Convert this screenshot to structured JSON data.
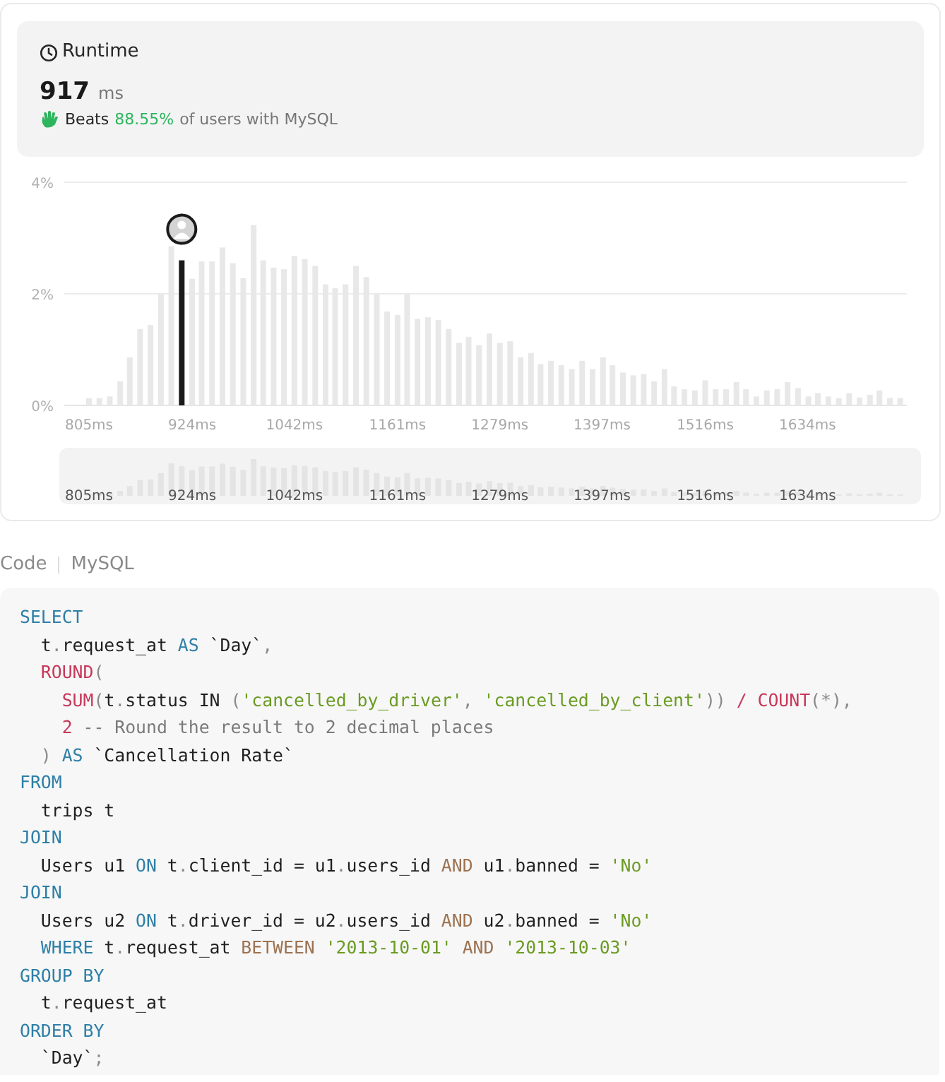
{
  "runtime": {
    "title": "Runtime",
    "value": "917",
    "unit": "ms",
    "beats_label": "Beats",
    "beats_percent": "88.55%",
    "beats_suffix": "of users with MySQL"
  },
  "chart": {
    "chart_data": {
      "type": "bar",
      "stacked": true,
      "xlim": [
        799,
        1752
      ],
      "ylim": [
        0,
        4
      ],
      "yticks": [
        {
          "value": 0,
          "label": "0%"
        },
        {
          "value": 2,
          "label": "2%"
        },
        {
          "value": 4,
          "label": "4%"
        }
      ],
      "xticks": [
        {
          "value": 805,
          "label": "805ms"
        },
        {
          "value": 924,
          "label": "924ms"
        },
        {
          "value": 1042,
          "label": "1042ms"
        },
        {
          "value": 1161,
          "label": "1161ms"
        },
        {
          "value": 1279,
          "label": "1279ms"
        },
        {
          "value": 1397,
          "label": "1397ms"
        },
        {
          "value": 1516,
          "label": "1516ms"
        },
        {
          "value": 1634,
          "label": "1634ms"
        }
      ],
      "x": [
        805,
        817,
        829,
        841,
        852,
        864,
        876,
        888,
        900,
        912,
        924,
        935,
        947,
        959,
        971,
        983,
        995,
        1006,
        1018,
        1030,
        1042,
        1054,
        1066,
        1078,
        1089,
        1101,
        1113,
        1125,
        1137,
        1149,
        1161,
        1172,
        1184,
        1196,
        1208,
        1220,
        1232,
        1243,
        1255,
        1267,
        1279,
        1291,
        1303,
        1315,
        1326,
        1338,
        1350,
        1362,
        1374,
        1386,
        1398,
        1409,
        1421,
        1433,
        1445,
        1457,
        1469,
        1480,
        1492,
        1504,
        1516,
        1528,
        1540,
        1552,
        1563,
        1575,
        1587,
        1599,
        1611,
        1623,
        1635,
        1646,
        1658,
        1670,
        1682,
        1694,
        1706,
        1717,
        1729,
        1741
      ],
      "series": [
        {
          "color": "#e8e8e8",
          "values": [
            0.13,
            0.13,
            0.16,
            0.43,
            0.86,
            1.37,
            1.44,
            2.0,
            2.85,
            null,
            2.27,
            2.58,
            2.58,
            2.83,
            2.55,
            2.28,
            3.23,
            2.6,
            2.47,
            2.44,
            2.68,
            2.62,
            2.5,
            2.17,
            2.1,
            2.17,
            2.5,
            2.3,
            2.0,
            1.68,
            1.62,
            2.0,
            1.55,
            1.58,
            1.53,
            1.37,
            1.12,
            1.23,
            1.08,
            1.29,
            1.12,
            1.15,
            0.86,
            0.94,
            0.74,
            0.8,
            0.72,
            0.65,
            0.8,
            0.65,
            0.86,
            0.72,
            0.59,
            0.54,
            0.56,
            0.43,
            0.65,
            0.34,
            0.29,
            0.27,
            0.45,
            0.29,
            0.29,
            0.42,
            0.29,
            0.16,
            0.27,
            0.29,
            0.42,
            0.31,
            0.16,
            0.22,
            0.16,
            0.13,
            0.22,
            0.14,
            0.19,
            0.27,
            0.13,
            0.13
          ]
        },
        {
          "color": "#1a1a1a",
          "values": [
            null,
            null,
            null,
            null,
            null,
            null,
            null,
            null,
            null,
            2.6,
            null,
            null,
            null,
            null,
            null,
            null,
            null,
            null,
            null,
            null,
            null,
            null,
            null,
            null,
            null,
            null,
            null,
            null,
            null,
            null,
            null,
            null,
            null,
            null,
            null,
            null,
            null,
            null,
            null,
            null,
            null,
            null,
            null,
            null,
            null,
            null,
            null,
            null,
            null,
            null,
            null,
            null,
            null,
            null,
            null,
            null,
            null,
            null,
            null,
            null,
            null,
            null,
            null,
            null,
            null,
            null,
            null,
            null,
            null,
            null,
            null,
            null,
            null,
            null,
            null,
            null,
            null,
            null,
            null,
            null
          ]
        }
      ]
    },
    "navigator_labels": [
      "805ms",
      "924ms",
      "1042ms",
      "1161ms",
      "1279ms",
      "1397ms",
      "1516ms",
      "1634ms"
    ]
  },
  "code_header": {
    "title": "Code",
    "language": "MySQL"
  },
  "code_lines": [
    {
      "tokens": [
        {
          "kind": "keyword",
          "text": "SELECT"
        }
      ],
      "children": [
        {
          "tokens": [
            {
              "kind": "plain",
              "text": "t"
            },
            {
              "kind": "punctuation",
              "text": "."
            },
            {
              "kind": "plain",
              "text": "request_at "
            },
            {
              "kind": "keyword",
              "text": "AS"
            },
            {
              "kind": "plain",
              "text": " `Day`"
            },
            {
              "kind": "punctuation",
              "text": ","
            }
          ]
        },
        {
          "tokens": [
            {
              "kind": "function",
              "text": "ROUND"
            },
            {
              "kind": "punctuation",
              "text": "("
            }
          ],
          "children": [
            {
              "tokens": [
                {
                  "kind": "function",
                  "text": "SUM"
                },
                {
                  "kind": "punctuation",
                  "text": "("
                },
                {
                  "kind": "plain",
                  "text": "t"
                },
                {
                  "kind": "punctuation",
                  "text": "."
                },
                {
                  "kind": "plain",
                  "text": "status IN "
                },
                {
                  "kind": "punctuation",
                  "text": "("
                },
                {
                  "kind": "string",
                  "text": "'cancelled_by_driver'"
                },
                {
                  "kind": "punctuation",
                  "text": ", "
                },
                {
                  "kind": "string",
                  "text": "'cancelled_by_client'"
                },
                {
                  "kind": "punctuation",
                  "text": "))"
                },
                {
                  "kind": "function",
                  "text": " / COUNT"
                },
                {
                  "kind": "punctuation",
                  "text": "(*),"
                }
              ]
            },
            {
              "tokens": [
                {
                  "kind": "function",
                  "text": "2"
                },
                {
                  "kind": "comment",
                  "text": " -- Round the result to 2 decimal places"
                }
              ]
            }
          ]
        },
        {
          "tokens": [
            {
              "kind": "punctuation",
              "text": ") "
            },
            {
              "kind": "keyword",
              "text": "AS"
            },
            {
              "kind": "plain",
              "text": " `Cancellation Rate`"
            }
          ]
        }
      ]
    },
    {
      "tokens": [
        {
          "kind": "keyword",
          "text": "FROM"
        }
      ],
      "children": [
        {
          "tokens": [
            {
              "kind": "plain",
              "text": "trips t"
            }
          ]
        }
      ]
    },
    {
      "tokens": [
        {
          "kind": "keyword",
          "text": "JOIN"
        }
      ],
      "children": [
        {
          "tokens": [
            {
              "kind": "plain",
              "text": "Users u1 "
            },
            {
              "kind": "keyword",
              "text": "ON"
            },
            {
              "kind": "plain",
              "text": " t"
            },
            {
              "kind": "punctuation",
              "text": "."
            },
            {
              "kind": "plain",
              "text": "client_id = u1"
            },
            {
              "kind": "punctuation",
              "text": "."
            },
            {
              "kind": "plain",
              "text": "users_id "
            },
            {
              "kind": "operator",
              "text": "AND"
            },
            {
              "kind": "plain",
              "text": " u1"
            },
            {
              "kind": "punctuation",
              "text": "."
            },
            {
              "kind": "plain",
              "text": "banned = "
            },
            {
              "kind": "string",
              "text": "'No'"
            }
          ]
        }
      ]
    },
    {
      "tokens": [
        {
          "kind": "keyword",
          "text": "JOIN"
        }
      ],
      "children": [
        {
          "tokens": [
            {
              "kind": "plain",
              "text": "Users u2 "
            },
            {
              "kind": "keyword",
              "text": "ON"
            },
            {
              "kind": "plain",
              "text": " t"
            },
            {
              "kind": "punctuation",
              "text": "."
            },
            {
              "kind": "plain",
              "text": "driver_id = u2"
            },
            {
              "kind": "punctuation",
              "text": "."
            },
            {
              "kind": "plain",
              "text": "users_id "
            },
            {
              "kind": "operator",
              "text": "AND"
            },
            {
              "kind": "plain",
              "text": " u2"
            },
            {
              "kind": "punctuation",
              "text": "."
            },
            {
              "kind": "plain",
              "text": "banned = "
            },
            {
              "kind": "string",
              "text": "'No'"
            }
          ]
        },
        {
          "tokens": [
            {
              "kind": "keyword",
              "text": "WHERE"
            },
            {
              "kind": "plain",
              "text": " t"
            },
            {
              "kind": "punctuation",
              "text": "."
            },
            {
              "kind": "plain",
              "text": "request_at "
            },
            {
              "kind": "operator",
              "text": "BETWEEN"
            },
            {
              "kind": "string",
              "text": " '2013-10-01'"
            },
            {
              "kind": "operator",
              "text": " AND "
            },
            {
              "kind": "string",
              "text": "'2013-10-03'"
            }
          ]
        }
      ]
    },
    {
      "tokens": [
        {
          "kind": "keyword",
          "text": "GROUP BY"
        }
      ],
      "children": [
        {
          "tokens": [
            {
              "kind": "plain",
              "text": "t"
            },
            {
              "kind": "punctuation",
              "text": "."
            },
            {
              "kind": "plain",
              "text": "request_at"
            }
          ]
        }
      ]
    },
    {
      "tokens": [
        {
          "kind": "keyword",
          "text": "ORDER BY"
        }
      ],
      "children": [
        {
          "tokens": [
            {
              "kind": "plain",
              "text": "`Day`"
            },
            {
              "kind": "punctuation",
              "text": ";"
            }
          ]
        }
      ]
    }
  ]
}
